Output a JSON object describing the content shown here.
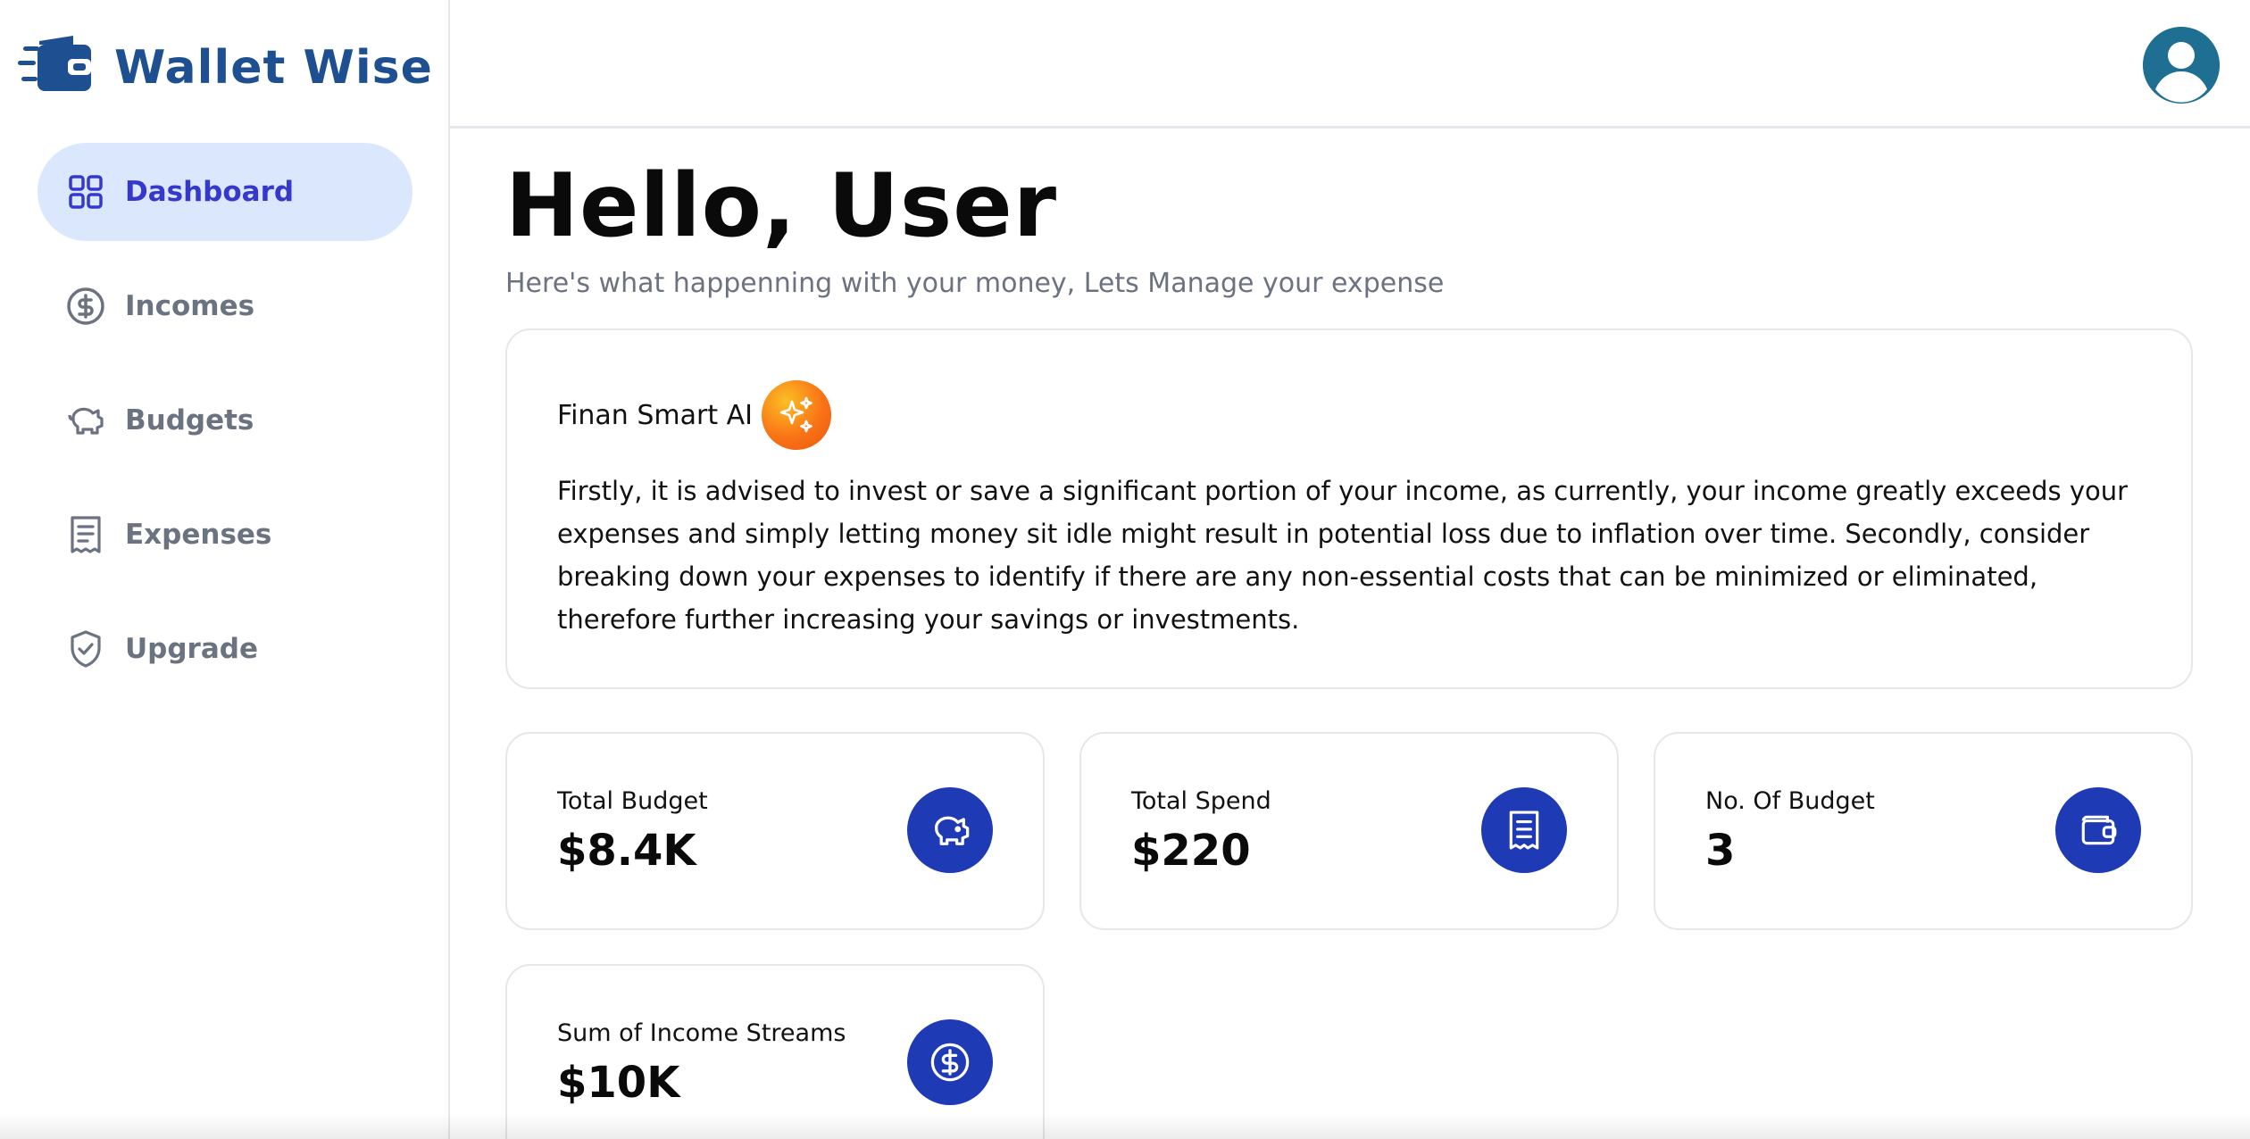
{
  "app": {
    "name": "Wallet Wise",
    "brand_color": "#1e4f91",
    "accent_color": "#3538cd",
    "icon_bg_color": "#1e3ab5"
  },
  "sidebar": {
    "items": [
      {
        "label": "Dashboard",
        "icon": "grid-icon",
        "active": true
      },
      {
        "label": "Incomes",
        "icon": "dollar-circle-icon",
        "active": false
      },
      {
        "label": "Budgets",
        "icon": "piggy-bank-icon",
        "active": false
      },
      {
        "label": "Expenses",
        "icon": "receipt-icon",
        "active": false
      },
      {
        "label": "Upgrade",
        "icon": "shield-check-icon",
        "active": false
      }
    ]
  },
  "header": {
    "avatar_icon": "user-avatar-icon"
  },
  "main": {
    "greeting": "Hello, User",
    "subtitle": "Here's what happenning with your money, Lets Manage your expense",
    "ai": {
      "title": "Finan Smart AI",
      "icon": "sparkles-icon",
      "text": "Firstly, it is advised to invest or save a significant portion of your income, as currently, your income greatly exceeds your expenses and simply letting money sit idle might result in potential loss due to inflation over time. Secondly, consider breaking down your expenses to identify if there are any non-essential costs that can be minimized or eliminated, therefore further increasing your savings or investments."
    },
    "stats": [
      {
        "label": "Total Budget",
        "value": "$8.4K",
        "icon": "piggy-bank-icon"
      },
      {
        "label": "Total Spend",
        "value": "$220",
        "icon": "receipt-icon"
      },
      {
        "label": "No. Of Budget",
        "value": "3",
        "icon": "wallet-icon"
      },
      {
        "label": "Sum of Income Streams",
        "value": "$10K",
        "icon": "dollar-circle-icon"
      }
    ]
  }
}
